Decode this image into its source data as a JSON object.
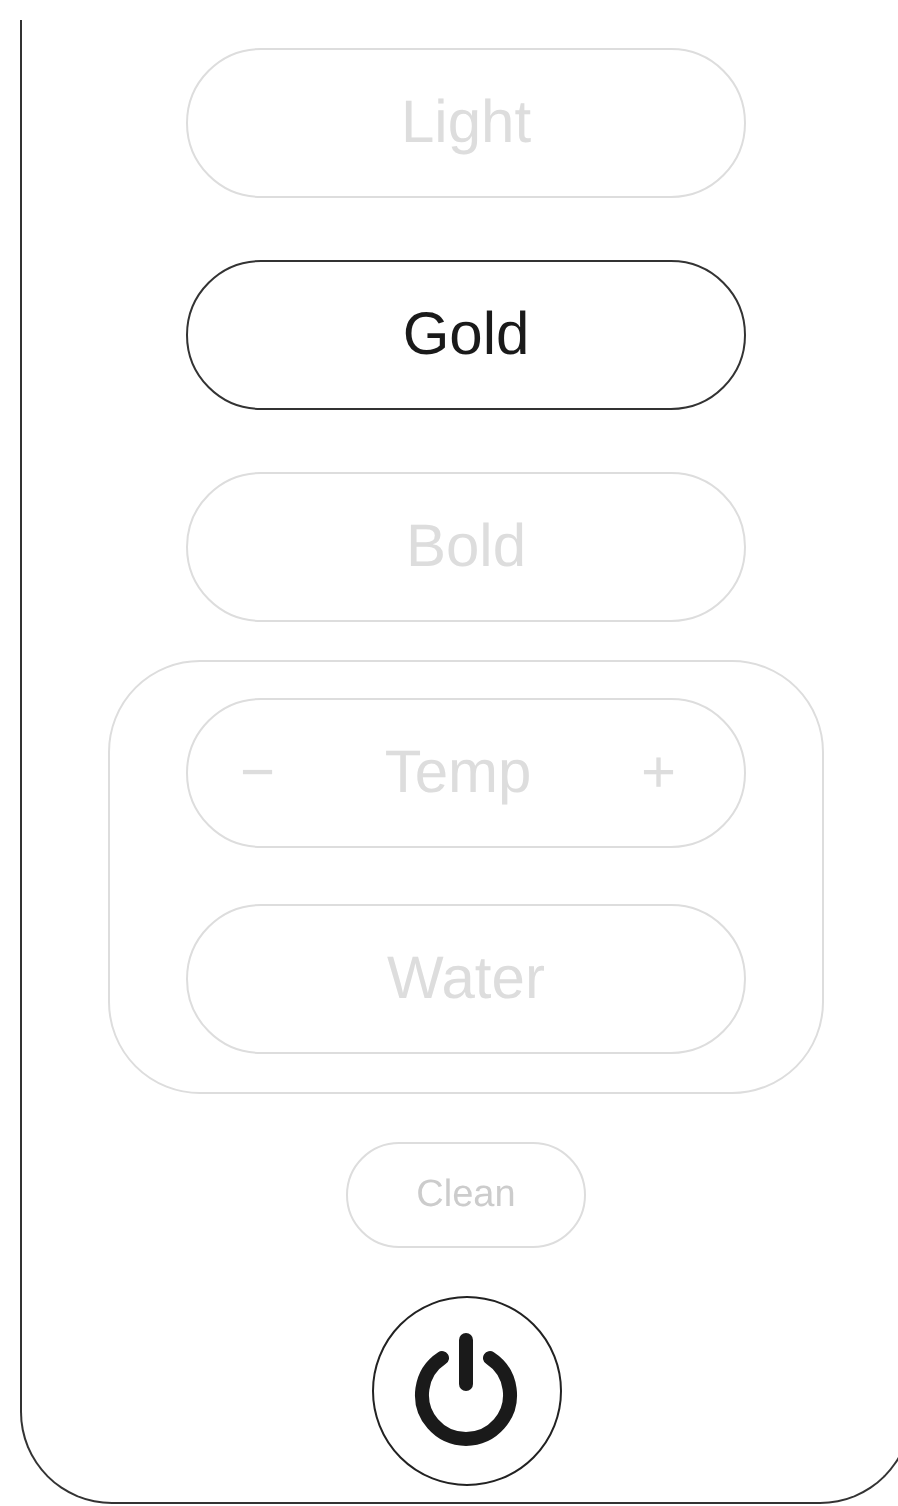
{
  "modes": [
    {
      "label": "Light",
      "selected": false
    },
    {
      "label": "Gold",
      "selected": true
    },
    {
      "label": "Bold",
      "selected": false
    }
  ],
  "temp": {
    "minus": "−",
    "label": "Temp",
    "plus": "+",
    "disabled": true
  },
  "water": {
    "label": "Water",
    "disabled": true
  },
  "clean": {
    "label": "Clean",
    "disabled": true
  },
  "power": {
    "on": true
  }
}
